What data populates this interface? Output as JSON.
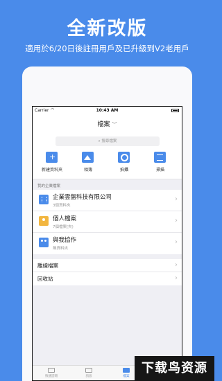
{
  "promo": {
    "title": "全新改版",
    "subtitle": "適用於6/20日後註冊用戶及已升級到V2老用戶"
  },
  "status_bar": {
    "carrier": "Carrier",
    "time": "10:43 AM"
  },
  "nav": {
    "title": "檔案"
  },
  "search": {
    "placeholder": "搜尋檔案"
  },
  "quick_actions": [
    {
      "label": "新建資料夾",
      "icon": "new-folder-icon"
    },
    {
      "label": "相簿",
      "icon": "album-icon"
    },
    {
      "label": "拍攝",
      "icon": "camera-icon"
    },
    {
      "label": "掃描",
      "icon": "scan-icon"
    }
  ],
  "section_label": "我的企業檔案",
  "folders": [
    {
      "title": "企業雲盤科技有限公司",
      "subtitle": "3個資料夾",
      "icon": "company-folder-icon"
    },
    {
      "title": "個人檔案",
      "subtitle": "7個檔案(夾)",
      "icon": "personal-folder-icon"
    },
    {
      "title": "與我協作",
      "subtitle": "無資料夾",
      "icon": "shared-folder-icon"
    }
  ],
  "other_items": [
    {
      "title": "離線檔案"
    },
    {
      "title": "回收站"
    }
  ],
  "tabbar": [
    {
      "label": "快速訪問"
    },
    {
      "label": "訊息"
    },
    {
      "label": "檔案"
    },
    {
      "label": "我"
    }
  ],
  "watermark": "下载鸟资源",
  "colors": {
    "background": "#4a8bea",
    "accent": "#4a8bea",
    "personal_folder": "#f2b640"
  }
}
